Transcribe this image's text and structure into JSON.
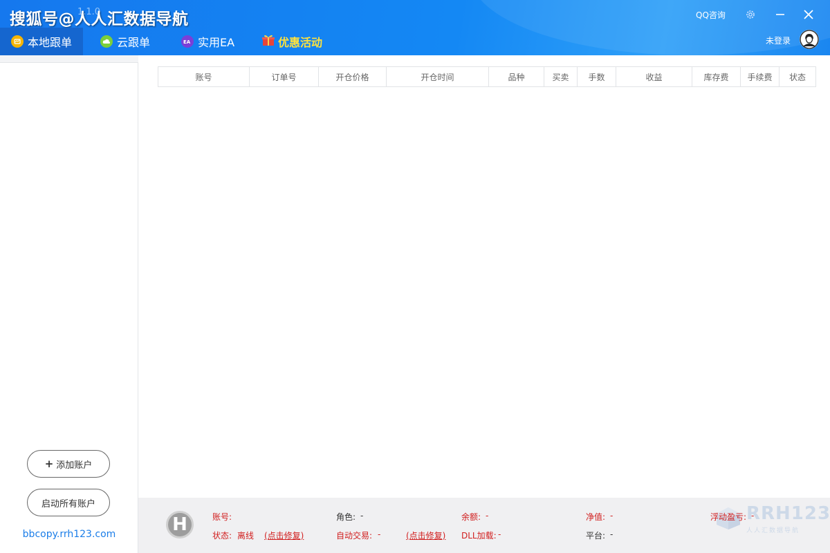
{
  "header": {
    "title": "搜狐号@人人汇数据导航",
    "version": "1.1.0",
    "qq_consult": "QQ咨询",
    "login_status": "未登录",
    "colors": {
      "primary": "#1578ee",
      "active_tab": "#1566cf",
      "promo": "#ffe23d"
    }
  },
  "tabs": [
    {
      "label": "本地跟单",
      "icon": "local-follow-icon",
      "active": true
    },
    {
      "label": "云跟单",
      "icon": "cloud-follow-icon",
      "active": false
    },
    {
      "label": "实用EA",
      "icon": "ea-icon",
      "active": false
    },
    {
      "label": "优惠活动",
      "icon": "gift-icon",
      "active": false
    }
  ],
  "sidebar": {
    "add_account": "添加账户",
    "start_all": "启动所有账户",
    "website": "bbcopy.rrh123.com"
  },
  "table": {
    "columns": [
      "账号",
      "订单号",
      "开仓价格",
      "开仓时间",
      "品种",
      "买卖",
      "手数",
      "收益",
      "库存费",
      "手续费",
      "状态"
    ],
    "rows": []
  },
  "footer": {
    "account_label": "账号:",
    "status_label": "状态:",
    "status_value": "离线",
    "repair_link": "(点击修复)",
    "role_label": "角色:",
    "role_value": "-",
    "auto_trade_label": "自动交易:",
    "auto_trade_value": "-",
    "repair_link2": "(点击修复)",
    "balance_label": "余额:",
    "balance_value": "-",
    "dll_label": "DLL加载:",
    "dll_value": "-",
    "equity_label": "净值:",
    "equity_value": "-",
    "platform_label": "平台:",
    "platform_value": "-",
    "floating_label": "浮动盈亏:",
    "floating_value": "-",
    "logo_letter": "H",
    "watermark_big": "RRH123",
    "watermark_small": "人人汇数据导航"
  }
}
